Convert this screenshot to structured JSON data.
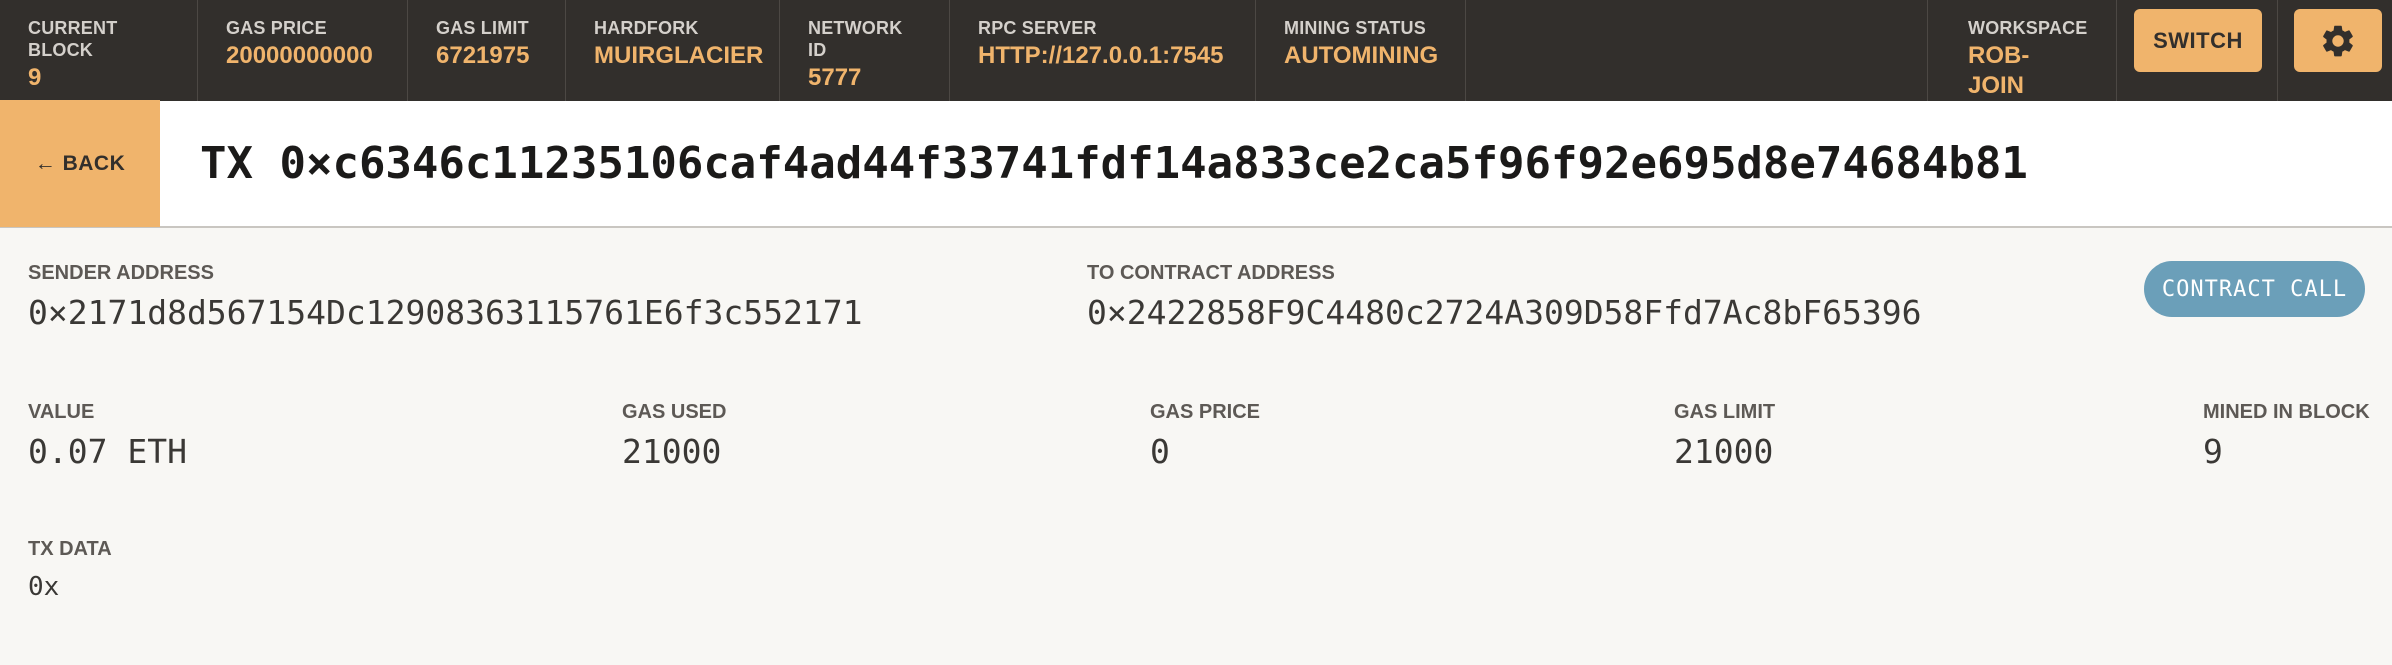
{
  "topbar": {
    "current_block": {
      "label": "CURRENT BLOCK",
      "value": "9"
    },
    "gas_price": {
      "label": "GAS PRICE",
      "value": "20000000000"
    },
    "gas_limit": {
      "label": "GAS LIMIT",
      "value": "6721975"
    },
    "hardfork": {
      "label": "HARDFORK",
      "value": "MUIRGLACIER"
    },
    "network_id": {
      "label": "NETWORK ID",
      "value": "5777"
    },
    "rpc_server": {
      "label": "RPC SERVER",
      "value": "HTTP://127.0.0.1:7545"
    },
    "mining_status": {
      "label": "MINING STATUS",
      "value": "AUTOMINING"
    },
    "workspace": {
      "label": "WORKSPACE",
      "value": "ROB-JOIN"
    },
    "switch_label": "SWITCH",
    "settings_icon": "gear-icon"
  },
  "tx": {
    "back_label": "← BACK",
    "title": "TX 0×c6346c11235106caf4ad44f33741fdf14a833ce2ca5f96f92e695d8e74684b81"
  },
  "details": {
    "sender": {
      "label": "SENDER ADDRESS",
      "value": "0×2171d8d567154Dc12908363115761E6f3c552171"
    },
    "to_contract": {
      "label": "TO CONTRACT ADDRESS",
      "value": "0×2422858F9C4480c2724A309D58Ffd7Ac8bF65396"
    },
    "badge": "CONTRACT CALL",
    "value": {
      "label": "VALUE",
      "value": "0.07 ETH"
    },
    "gas_used": {
      "label": "GAS USED",
      "value": "21000"
    },
    "gas_price": {
      "label": "GAS PRICE",
      "value": "0"
    },
    "gas_limit": {
      "label": "GAS LIMIT",
      "value": "21000"
    },
    "mined_in_block": {
      "label": "MINED IN BLOCK",
      "value": "9"
    },
    "tx_data": {
      "label": "TX DATA",
      "value": "0x"
    }
  },
  "colors": {
    "topbar_bg": "#322f2c",
    "accent": "#f0b46c",
    "badge": "#6b9fb9",
    "page_bg": "#f8f7f4"
  }
}
